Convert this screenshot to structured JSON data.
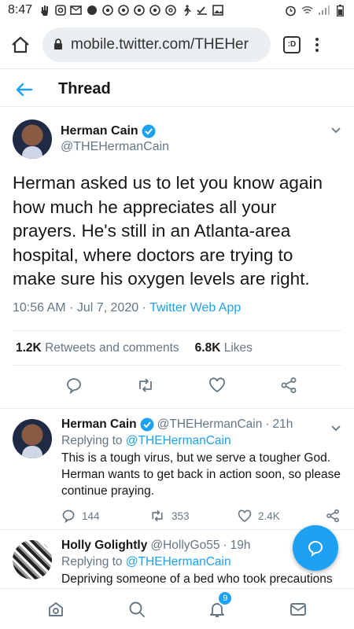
{
  "status_bar": {
    "time": "8:47"
  },
  "browser": {
    "url": "mobile.twitter.com/THEHer",
    "tab_label": ":D"
  },
  "header": {
    "title": "Thread"
  },
  "main_tweet": {
    "name": "Herman Cain",
    "handle": "@THEHermanCain",
    "text": "Herman asked us to let you know again how much he appreciates all your prayers. He's still in an Atlanta-area hospital, where doctors are trying to make sure his oxygen levels are right.",
    "time": "10:56 AM",
    "date": "Jul 7, 2020",
    "sep1": "·",
    "sep2": "·",
    "app": "Twitter Web App",
    "retweets_count": "1.2K",
    "retweets_label": "Retweets and comments",
    "likes_count": "6.8K",
    "likes_label": "Likes"
  },
  "replies": [
    {
      "name": "Herman Cain",
      "handle": "@THEHermanCain",
      "sep": "·",
      "age": "21h",
      "replying_prefix": "Replying to",
      "replying_to": "@THEHermanCain",
      "text": "This is a tough virus, but we serve a tougher God. Herman wants to get back in action soon, so please continue praying.",
      "comments": "144",
      "retweets": "353",
      "likes": "2.4K"
    },
    {
      "name": "Holly Golightly",
      "handle": "@HollyGo55",
      "sep": "·",
      "age": "19h",
      "replying_prefix": "Replying to",
      "replying_to": "@THEHermanCain",
      "text": "Depriving someone of a bed who took precautions"
    }
  ],
  "bottom_nav": {
    "notifications_badge": "9"
  },
  "colors": {
    "accent": "#1da1f2",
    "text": "#14171a",
    "muted": "#657786"
  }
}
